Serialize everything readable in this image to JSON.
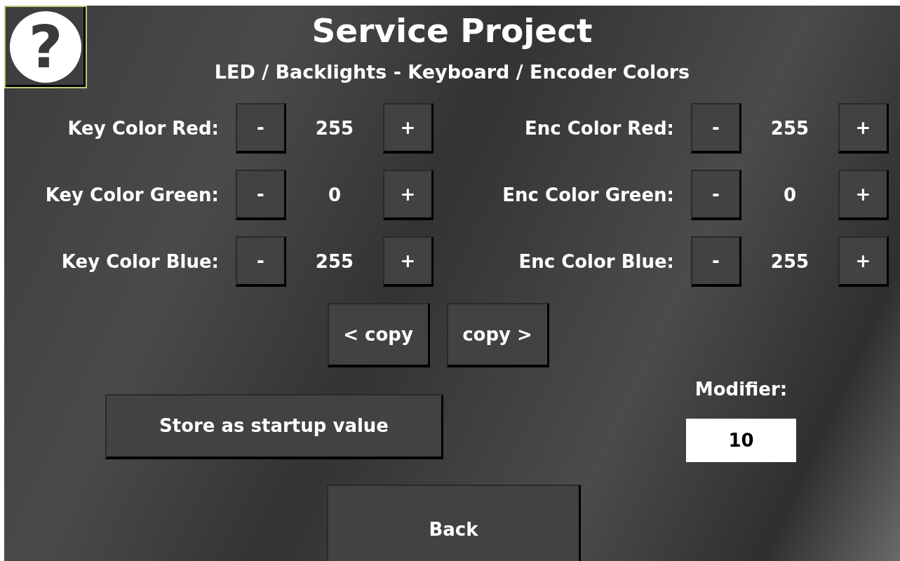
{
  "help_button": {
    "symbol": "?"
  },
  "title": "Service Project",
  "subtitle": "LED / Backlights - Keyboard / Encoder Colors",
  "left_controls": [
    {
      "label": "Key Color Red:",
      "decrement": "-",
      "value": "255",
      "increment": "+"
    },
    {
      "label": "Key Color Green:",
      "decrement": "-",
      "value": "0",
      "increment": "+"
    },
    {
      "label": "Key Color Blue:",
      "decrement": "-",
      "value": "255",
      "increment": "+"
    }
  ],
  "right_controls": [
    {
      "label": "Enc Color Red:",
      "decrement": "-",
      "value": "255",
      "increment": "+"
    },
    {
      "label": "Enc Color Green:",
      "decrement": "-",
      "value": "0",
      "increment": "+"
    },
    {
      "label": "Enc Color Blue:",
      "decrement": "-",
      "value": "255",
      "increment": "+"
    }
  ],
  "copy_buttons": [
    "< copy",
    "copy >"
  ],
  "store_button": "Store as startup value",
  "modifier": {
    "label": "Modifier:",
    "value": "10"
  },
  "back_button": "Back"
}
